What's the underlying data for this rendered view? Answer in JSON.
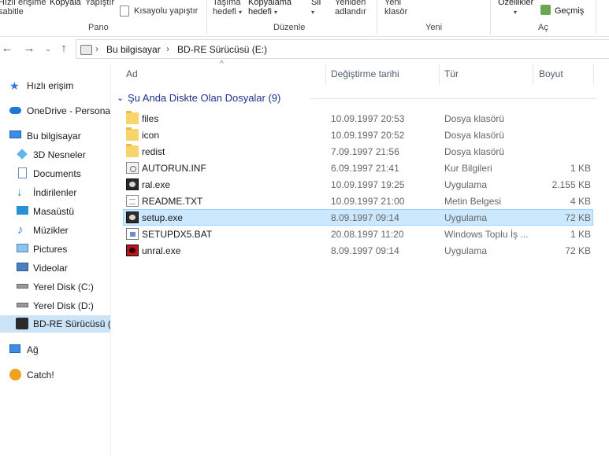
{
  "ribbon": {
    "pano": {
      "quick_access_1": "Hızlı erişime",
      "quick_access_2": "sabitle",
      "copy": "Kopyala",
      "paste": "Yapıştır",
      "paste_shortcut": "Kısayolu yapıştır",
      "group": "Pano"
    },
    "organize": {
      "move_1": "Taşıma",
      "move_2": "hedefi",
      "copyto_1": "Kopyalama",
      "copyto_2": "hedefi",
      "delete": "Sil",
      "rename_1": "Yeniden",
      "rename_2": "adlandır",
      "group": "Düzenle"
    },
    "new": {
      "newfolder_1": "Yeni",
      "newfolder_2": "klasör",
      "group": "Yeni"
    },
    "open": {
      "properties": "Özellikler",
      "history": "Geçmiş",
      "group": "Aç"
    }
  },
  "address": {
    "crumbs": [
      "Bu bilgisayar",
      "BD-RE Sürücüsü (E:)"
    ]
  },
  "sidebar": {
    "items": [
      {
        "label": "Hızlı erişim",
        "icon": "star-icon"
      },
      {
        "label": "OneDrive - Personal",
        "icon": "cloud-icon"
      },
      {
        "label": "Bu bilgisayar",
        "icon": "computer-icon"
      },
      {
        "label": "3D Nesneler",
        "icon": "cube-icon"
      },
      {
        "label": "Documents",
        "icon": "documents-icon"
      },
      {
        "label": "İndirilenler",
        "icon": "download-icon"
      },
      {
        "label": "Masaüstü",
        "icon": "desktop-icon"
      },
      {
        "label": "Müzikler",
        "icon": "music-icon"
      },
      {
        "label": "Pictures",
        "icon": "pictures-icon"
      },
      {
        "label": "Videolar",
        "icon": "video-icon"
      },
      {
        "label": "Yerel Disk (C:)",
        "icon": "drive-icon"
      },
      {
        "label": "Yerel Disk (D:)",
        "icon": "drive-icon"
      },
      {
        "label": "BD-RE Sürücüsü (E",
        "icon": "disc-icon"
      },
      {
        "label": "Ağ",
        "icon": "network-icon"
      },
      {
        "label": "Catch!",
        "icon": "catch-icon"
      }
    ]
  },
  "columns": {
    "name": "Ad",
    "date": "Değiştirme tarihi",
    "type": "Tür",
    "size": "Boyut"
  },
  "group_header": "Şu Anda Diskte Olan Dosyalar (9)",
  "files": [
    {
      "name": "files",
      "date": "10.09.1997 20:53",
      "type": "Dosya klasörü",
      "size": "",
      "icon": "folder-icon"
    },
    {
      "name": "icon",
      "date": "10.09.1997 20:52",
      "type": "Dosya klasörü",
      "size": "",
      "icon": "folder-icon"
    },
    {
      "name": "redist",
      "date": "7.09.1997 21:56",
      "type": "Dosya klasörü",
      "size": "",
      "icon": "folder-icon"
    },
    {
      "name": "AUTORUN.INF",
      "date": "6.09.1997 21:41",
      "type": "Kur Bilgileri",
      "size": "1 KB",
      "icon": "settings-file-icon"
    },
    {
      "name": "ral.exe",
      "date": "10.09.1997 19:25",
      "type": "Uygulama",
      "size": "2.155 KB",
      "icon": "app-icon"
    },
    {
      "name": "README.TXT",
      "date": "10.09.1997 21:00",
      "type": "Metin Belgesi",
      "size": "4 KB",
      "icon": "text-file-icon"
    },
    {
      "name": "setup.exe",
      "date": "8.09.1997 09:14",
      "type": "Uygulama",
      "size": "72 KB",
      "icon": "app-icon"
    },
    {
      "name": "SETUPDX5.BAT",
      "date": "20.08.1997 11:20",
      "type": "Windows Toplu İş ...",
      "size": "1 KB",
      "icon": "batch-file-icon"
    },
    {
      "name": "unral.exe",
      "date": "8.09.1997 09:14",
      "type": "Uygulama",
      "size": "72 KB",
      "icon": "app-icon"
    }
  ],
  "colors": {
    "selection": "#cce8ff",
    "selection_border": "#99d1ff",
    "group_header": "#1e3287"
  }
}
